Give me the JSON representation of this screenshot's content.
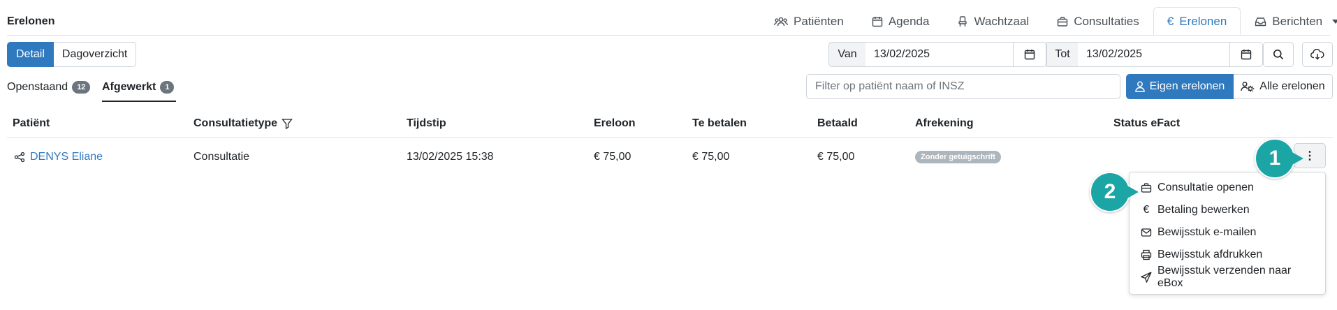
{
  "page_title": "Erelonen",
  "nav": {
    "tabs": [
      {
        "label": "Patiënten",
        "icon": "users-icon"
      },
      {
        "label": "Agenda",
        "icon": "calendar-icon"
      },
      {
        "label": "Wachtzaal",
        "icon": "chair-icon"
      },
      {
        "label": "Consultaties",
        "icon": "briefcase-icon"
      },
      {
        "label": "Erelonen",
        "icon": "euro-icon",
        "active": true
      },
      {
        "label": "Berichten",
        "icon": "inbox-icon"
      }
    ]
  },
  "view_toggle": {
    "detail": "Detail",
    "day": "Dagoverzicht"
  },
  "date_range": {
    "from_label": "Van",
    "from_value": "13/02/2025",
    "to_label": "Tot",
    "to_value": "13/02/2025"
  },
  "status_tabs": {
    "open": {
      "label": "Openstaand",
      "count": "12"
    },
    "done": {
      "label": "Afgewerkt",
      "count": "1"
    }
  },
  "filter": {
    "placeholder": "Filter op patiënt naam of INSZ"
  },
  "scope": {
    "own": "Eigen erelonen",
    "all": "Alle erelonen"
  },
  "table": {
    "headers": {
      "patient": "Patiënt",
      "type": "Consultatietype",
      "time": "Tijdstip",
      "fee": "Ereloon",
      "to_pay": "Te betalen",
      "paid": "Betaald",
      "settlement": "Afrekening",
      "efact": "Status eFact"
    },
    "rows": [
      {
        "patient": "DENYS Eliane",
        "type": "Consultatie",
        "time": "13/02/2025 15:38",
        "fee": "€ 75,00",
        "to_pay": "€ 75,00",
        "paid": "€ 75,00",
        "settlement": "Zonder getuigschrift",
        "efact": "",
        "actions": "⋮"
      }
    ]
  },
  "actions_menu": {
    "items": [
      {
        "label": "Consultatie openen",
        "icon": "briefcase-icon"
      },
      {
        "label": "Betaling bewerken",
        "icon": "euro-icon"
      },
      {
        "label": "Bewijsstuk e-mailen",
        "icon": "envelope-icon"
      },
      {
        "label": "Bewijsstuk afdrukken",
        "icon": "printer-icon"
      },
      {
        "label": "Bewijsstuk verzenden naar eBox",
        "icon": "send-icon"
      }
    ]
  },
  "callouts": {
    "one": "1",
    "two": "2"
  },
  "colors": {
    "primary": "#2f79bf",
    "callout": "#1ba5a5",
    "badge": "#6c757d",
    "pill": "#adb5bd"
  }
}
